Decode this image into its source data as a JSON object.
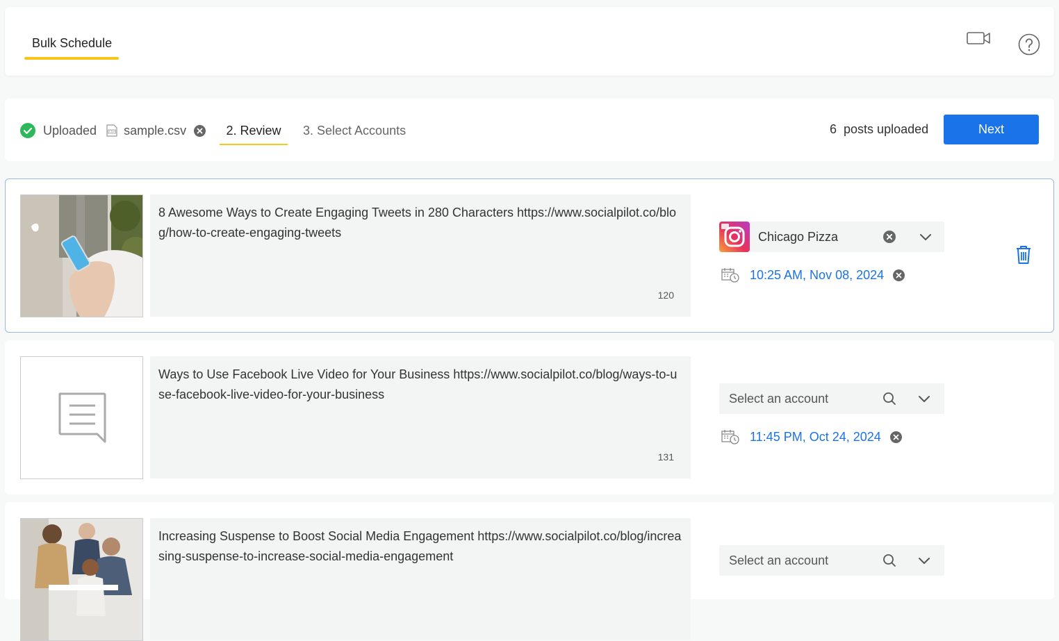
{
  "header": {
    "tab_label": "Bulk Schedule"
  },
  "steps": {
    "uploaded_label": "Uploaded",
    "file_name": "sample.csv",
    "review_label": "2. Review",
    "accounts_label": "3. Select Accounts",
    "posts_count": "6",
    "posts_label": "posts uploaded",
    "next_label": "Next"
  },
  "colors": {
    "accent": "#1a73e8",
    "tab_underline": "#f7c61a",
    "success": "#2eb85c"
  },
  "posts": [
    {
      "text": "8 Awesome Ways to Create Engaging Tweets in 280 Characters https://www.socialpilot.co/blog/how-to-create-engaging-tweets",
      "char_count": "120",
      "account": "Chicago Pizza",
      "account_icon": "instagram-icon",
      "schedule": "10:25 AM, Nov 08, 2024",
      "thumb": "photo-hand-phone"
    },
    {
      "text": "Ways to Use Facebook Live Video for Your Business https://www.socialpilot.co/blog/ways-to-use-facebook-live-video-for-your-business",
      "char_count": "131",
      "account_placeholder": "Select an account",
      "schedule": "11:45 PM, Oct 24, 2024",
      "thumb": "placeholder-text-icon"
    },
    {
      "text": "Increasing Suspense to Boost Social Media Engagement https://www.socialpilot.co/blog/increasing-suspense-to-increase-social-media-engagement",
      "account_placeholder": "Select an account",
      "thumb": "photo-team"
    }
  ]
}
